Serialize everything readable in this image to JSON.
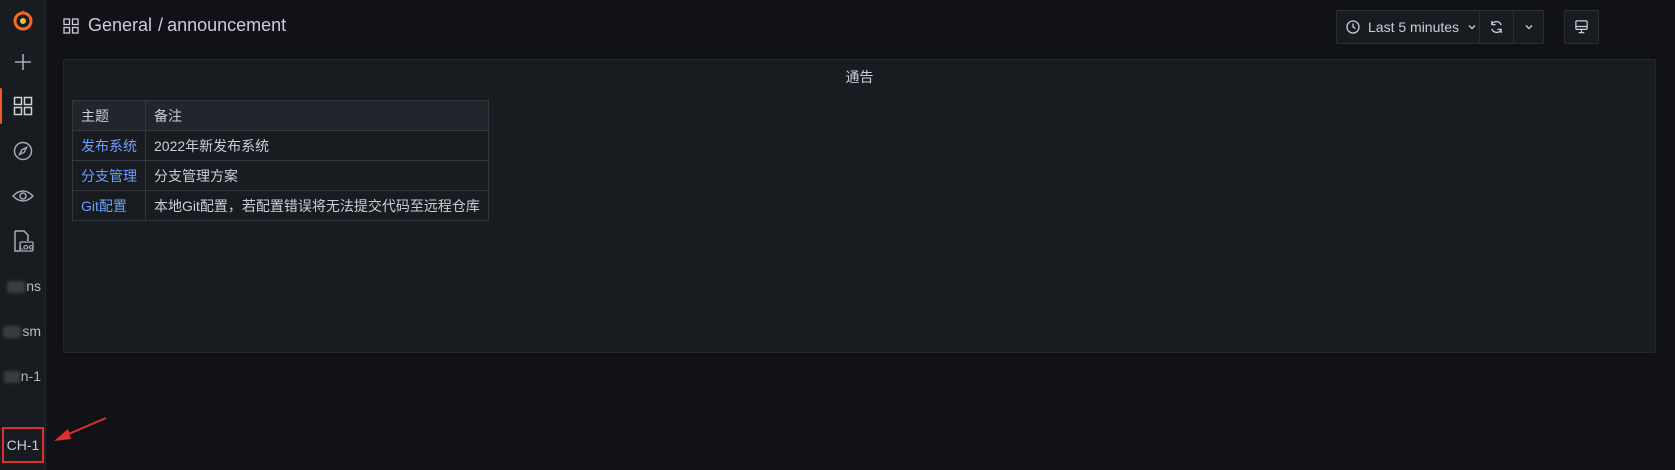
{
  "breadcrumb": {
    "folder": "General",
    "separator": "/",
    "dashboard": "announcement"
  },
  "toolbar": {
    "time_range": "Last 5 minutes"
  },
  "sidebar": {
    "icons": [
      "grafana-logo",
      "plus-icon",
      "dashboards-icon",
      "explore-compass-icon",
      "alerting-eye-icon",
      "logs-icon"
    ],
    "text_items": [
      "ns",
      "sm",
      "n-1",
      "CH-1"
    ]
  },
  "panel": {
    "title": "通告",
    "columns": [
      "主题",
      "备注"
    ],
    "rows": [
      {
        "topic": "发布系统",
        "note": "2022年新发布系统"
      },
      {
        "topic": "分支管理",
        "note": "分支管理方案"
      },
      {
        "topic": "Git配置",
        "note": "本地Git配置，若配置错误将无法提交代码至远程仓库"
      }
    ]
  },
  "colors": {
    "accent": "#f05a28",
    "link": "#6e9fff",
    "highlight": "#e02f2f"
  }
}
